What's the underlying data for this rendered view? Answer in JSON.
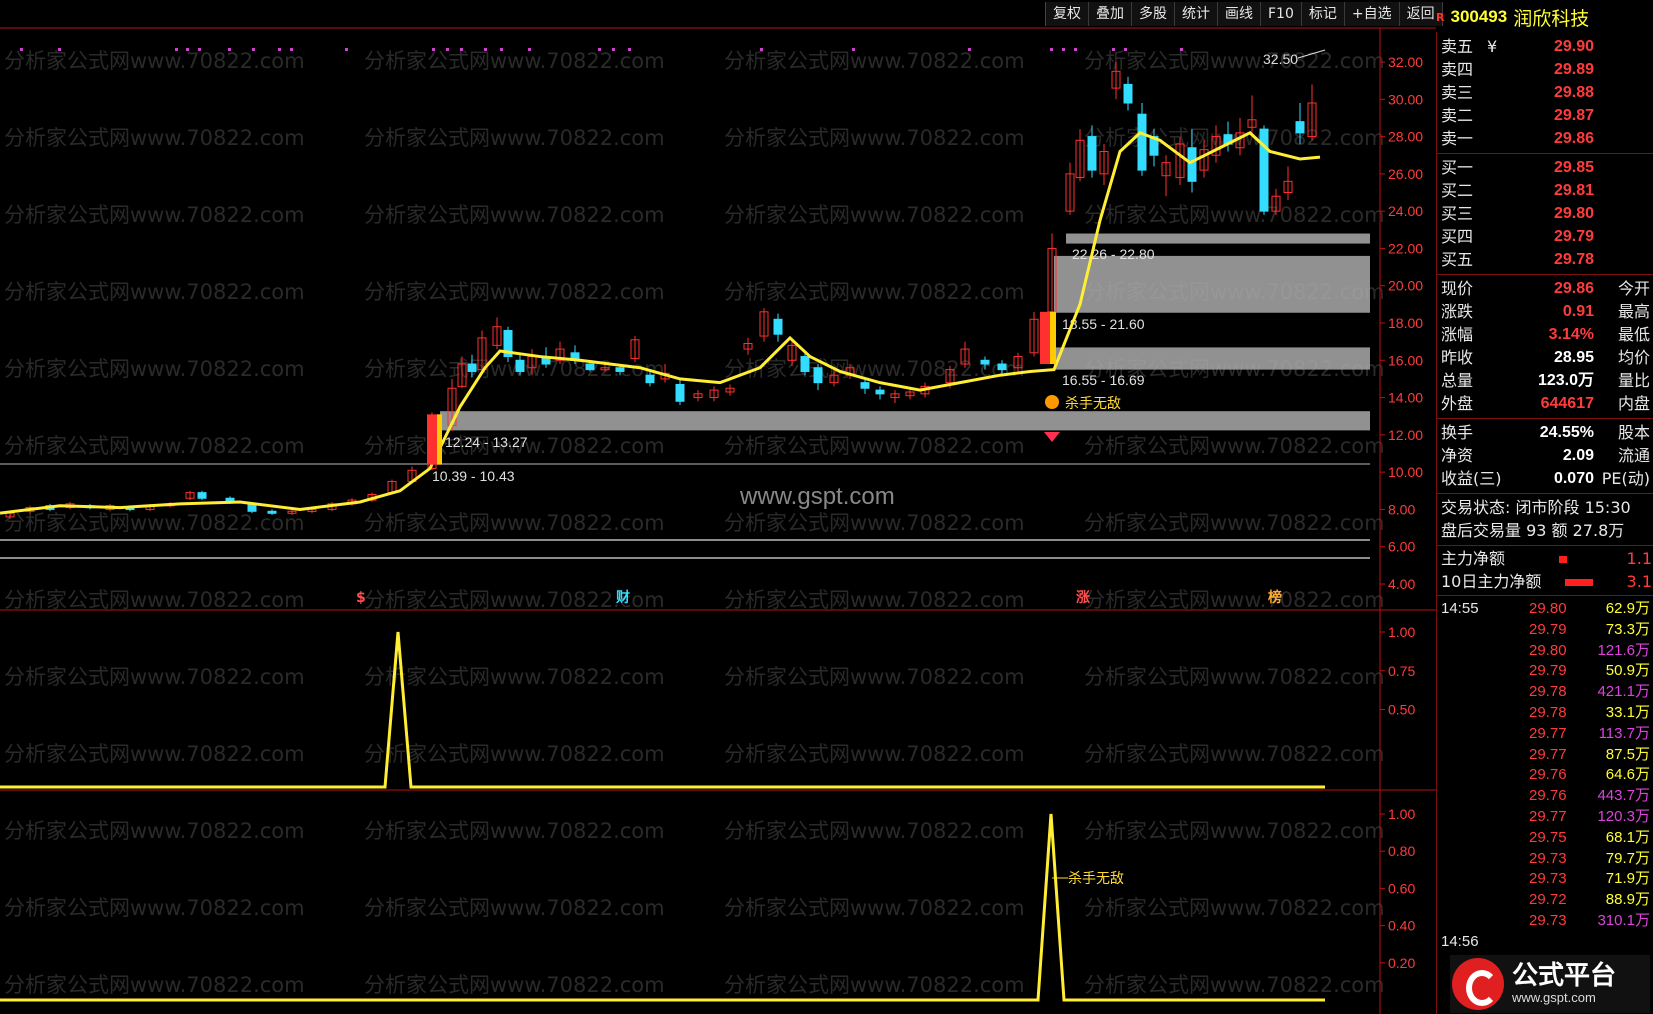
{
  "toolbar": [
    "复权",
    "叠加",
    "多股",
    "统计",
    "画线",
    "F10",
    "标记",
    "+自选",
    "返回"
  ],
  "stock": {
    "flag": "R",
    "code": "300493",
    "name": "润欣科技"
  },
  "watermark": "分析家公式网www.70822.com",
  "center_watermark": "www.gspt.com",
  "main_chart": {
    "y_ticks": [
      "32.00",
      "30.00",
      "28.00",
      "26.00",
      "24.00",
      "22.00",
      "20.00",
      "18.00",
      "16.00",
      "14.00",
      "12.00",
      "10.00",
      "8.00",
      "6.00",
      "4.00"
    ],
    "peak_label": "32.50",
    "zones": [
      "22.26 - 22.80",
      "18.55 - 21.60",
      "16.55 - 16.69",
      "12.24 - 13.27",
      "10.39 - 10.43"
    ],
    "signal_label": "杀手无敌",
    "event_markers": [
      "$",
      "财",
      "涨",
      "榜"
    ],
    "colors": {
      "up": "#ff3030",
      "down": "#33ddff",
      "ma": "#ffee33",
      "zone": "#aaaaaa",
      "axis": "#c01010"
    }
  },
  "sub_chart1": {
    "y_ticks": [
      "1.00",
      "0.75",
      "0.50"
    ]
  },
  "sub_chart2": {
    "y_ticks": [
      "1.00",
      "0.80",
      "0.60",
      "0.40",
      "0.20"
    ],
    "signal_label": "杀手无敌"
  },
  "order_book": {
    "asks": [
      {
        "label": "卖五",
        "price": "29.90",
        "mark": "¥"
      },
      {
        "label": "卖四",
        "price": "29.89"
      },
      {
        "label": "卖三",
        "price": "29.88"
      },
      {
        "label": "卖二",
        "price": "29.87"
      },
      {
        "label": "卖一",
        "price": "29.86"
      }
    ],
    "bids": [
      {
        "label": "买一",
        "price": "29.85"
      },
      {
        "label": "买二",
        "price": "29.81"
      },
      {
        "label": "买三",
        "price": "29.80"
      },
      {
        "label": "买四",
        "price": "29.79"
      },
      {
        "label": "买五",
        "price": "29.78"
      }
    ]
  },
  "quote": [
    {
      "label": "现价",
      "value": "29.86",
      "label2": "今开"
    },
    {
      "label": "涨跌",
      "value": "0.91",
      "label2": "最高"
    },
    {
      "label": "涨幅",
      "value": "3.14%",
      "label2": "最低"
    },
    {
      "label": "昨收",
      "value": "28.95",
      "label2": "均价",
      "white": true
    },
    {
      "label": "总量",
      "value": "123.0万",
      "label2": "量比",
      "white": true
    },
    {
      "label": "外盘",
      "value": "644617",
      "label2": "内盘"
    }
  ],
  "fundamentals": [
    {
      "label": "换手",
      "value": "24.55%",
      "label2": "股本"
    },
    {
      "label": "净资",
      "value": "2.09",
      "label2": "流通"
    },
    {
      "label": "收益(三)",
      "value": "0.070",
      "label2": "PE(动)"
    }
  ],
  "trade_status": {
    "line1": "交易状态: 闭市阶段 15:30",
    "line2": "盘后交易量 93 额 27.8万"
  },
  "capital": [
    {
      "label": "主力净额",
      "value": "1.1"
    },
    {
      "label": "10日主力净额",
      "value": "3.1"
    }
  ],
  "ticks": {
    "time": "14:55",
    "time2": "14:56",
    "rows": [
      {
        "price": "29.80",
        "vol": "62.9万",
        "color": "#ffff33"
      },
      {
        "price": "29.79",
        "vol": "73.3万",
        "color": "#ffff33"
      },
      {
        "price": "29.80",
        "vol": "121.6万",
        "color": "#dd44dd"
      },
      {
        "price": "29.79",
        "vol": "50.9万",
        "color": "#ffff33"
      },
      {
        "price": "29.78",
        "vol": "421.1万",
        "color": "#dd44dd"
      },
      {
        "price": "29.78",
        "vol": "33.1万",
        "color": "#ffff33"
      },
      {
        "price": "29.77",
        "vol": "113.7万",
        "color": "#dd44dd"
      },
      {
        "price": "29.77",
        "vol": "87.5万",
        "color": "#ffff33"
      },
      {
        "price": "29.76",
        "vol": "64.6万",
        "color": "#ffff33"
      },
      {
        "price": "29.76",
        "vol": "443.7万",
        "color": "#dd44dd"
      },
      {
        "price": "29.77",
        "vol": "120.3万",
        "color": "#dd44dd"
      },
      {
        "price": "29.75",
        "vol": "68.1万",
        "color": "#ffff33"
      },
      {
        "price": "29.73",
        "vol": "79.7万",
        "color": "#ffff33"
      },
      {
        "price": "29.73",
        "vol": "71.9万",
        "color": "#ffff33"
      },
      {
        "price": "29.72",
        "vol": "88.9万",
        "color": "#ffff33"
      },
      {
        "price": "29.73",
        "vol": "310.1万",
        "color": "#dd44dd"
      }
    ]
  },
  "logo": {
    "title": "公式平台",
    "url": "www.gspt.com"
  }
}
